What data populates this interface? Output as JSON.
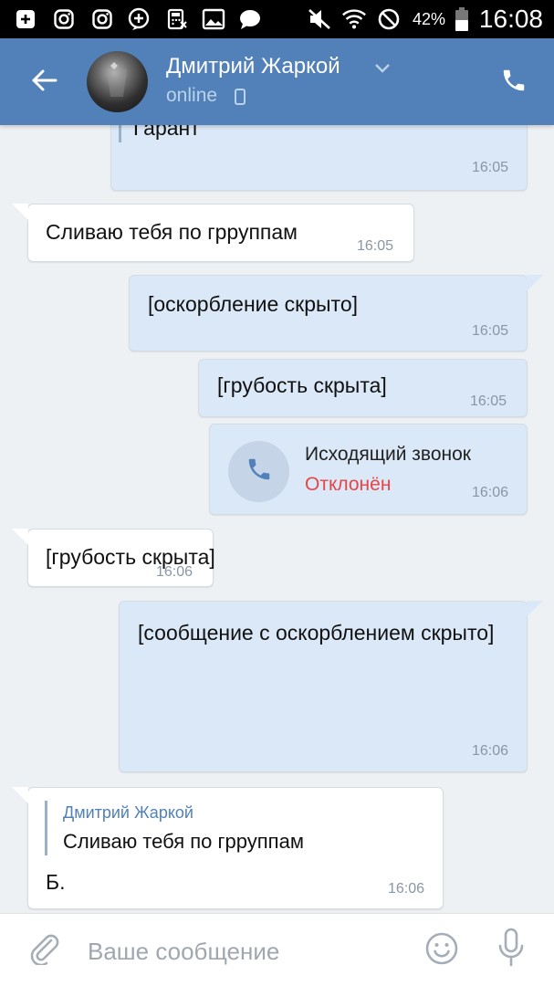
{
  "status_bar": {
    "battery": "42%",
    "time": "16:08",
    "icons": [
      "add-box-icon",
      "instagram-icon",
      "instagram-icon",
      "add-circle-icon",
      "calculator-icon",
      "image-icon",
      "chat-bubble-icon",
      "mute-icon",
      "wifi-icon",
      "blocked-icon",
      "battery-icon"
    ]
  },
  "header": {
    "contact_name": "Дмитрий Жаркой",
    "status": "online",
    "icons": [
      "back-arrow-icon",
      "chevron-down-icon",
      "mobile-phone-icon",
      "phone-icon"
    ]
  },
  "messages": [
    {
      "direction": "out",
      "text": "Гарант",
      "time": "16:05",
      "partial": true
    },
    {
      "direction": "in",
      "text": "Сливаю тебя по грруппам",
      "time": "16:05"
    },
    {
      "direction": "out",
      "text": "[оскорбление скрыто]",
      "time": "16:05"
    },
    {
      "direction": "out",
      "text": "[грубость скрыта]",
      "time": "16:05"
    },
    {
      "direction": "out",
      "type": "call",
      "title": "Исходящий звонок",
      "status": "Отклонён",
      "time": "16:06"
    },
    {
      "direction": "in",
      "text": "[грубость скрыта]",
      "time": "16:06"
    },
    {
      "direction": "out",
      "lines": [
        "[сообщение с оскорблением скрыто]"
      ],
      "time": "16:06"
    },
    {
      "direction": "in",
      "quote": {
        "author": "Дмитрий Жаркой",
        "text": "Сливаю тебя по грруппам"
      },
      "text": "Б.",
      "time": "16:06"
    }
  ],
  "input": {
    "placeholder": "Ваше сообщение",
    "icons": [
      "paperclip-icon",
      "emoji-icon",
      "microphone-icon"
    ]
  },
  "colors": {
    "header": "#5181b8",
    "outgoing_bubble": "#dbe8f7",
    "incoming_bubble": "#ffffff",
    "background": "#eef1f4",
    "declined": "#e64646"
  }
}
